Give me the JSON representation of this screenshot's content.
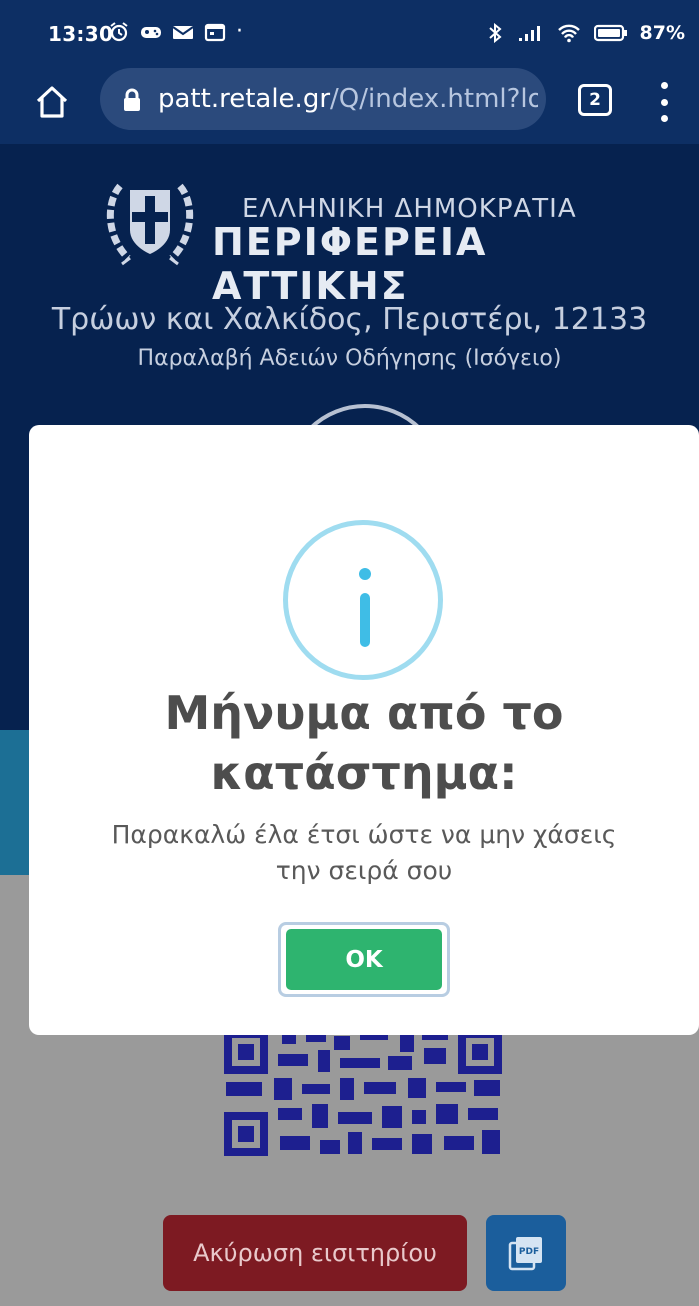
{
  "status_bar": {
    "time": "13:30",
    "battery": "87%"
  },
  "browser": {
    "url_domain": "patt.retale.gr",
    "url_path": "/Q/index.html?lo",
    "tab_count": "2"
  },
  "header": {
    "gov_title_line1": "ΕΛΛΗΝΙΚΗ ΔΗΜΟΚΡΑΤΙΑ",
    "gov_title_line2": "ΠΕΡΙΦΕΡΕΙΑ ΑΤΤΙΚΗΣ",
    "address": "Τρώων και Χαλκίδος, Περιστέρι, 12133",
    "service": "Παραλαβή Αδειών Οδήγησης (Ισόγειο)"
  },
  "dialog": {
    "title": "Μήνυμα από το κατάστημα:",
    "message": "Παρακαλώ έλα έτσι ώστε να μην χάσεις την σειρά σου",
    "ok_label": "OK"
  },
  "actions": {
    "cancel_ticket": "Ακύρωση εισιτηρίου",
    "pdf_label": "PDF"
  },
  "colors": {
    "header_bg": "#06224f",
    "ok_green": "#2eb46f",
    "cancel_red": "#7d1a22",
    "info_blue": "#3fbde6"
  }
}
